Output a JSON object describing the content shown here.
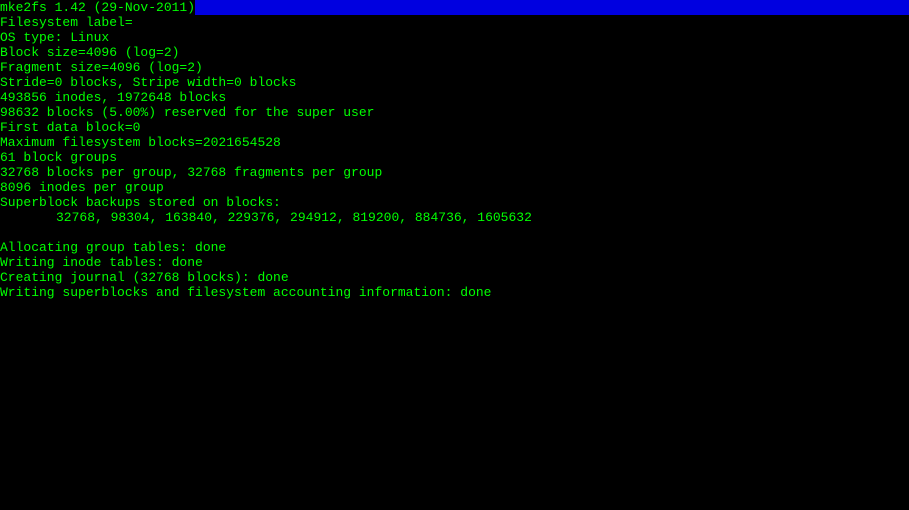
{
  "header": "mke2fs 1.42 (29-Nov-2011)",
  "lines": [
    "Filesystem label=",
    "OS type: Linux",
    "Block size=4096 (log=2)",
    "Fragment size=4096 (log=2)",
    "Stride=0 blocks, Stripe width=0 blocks",
    "493856 inodes, 1972648 blocks",
    "98632 blocks (5.00%) reserved for the super user",
    "First data block=0",
    "Maximum filesystem blocks=2021654528",
    "61 block groups",
    "32768 blocks per group, 32768 fragments per group",
    "8096 inodes per group",
    "Superblock backups stored on blocks:"
  ],
  "backup_blocks": "32768, 98304, 163840, 229376, 294912, 819200, 884736, 1605632",
  "status_lines": [
    "Allocating group tables: done",
    "Writing inode tables: done",
    "Creating journal (32768 blocks): done",
    "Writing superblocks and filesystem accounting information: done"
  ]
}
